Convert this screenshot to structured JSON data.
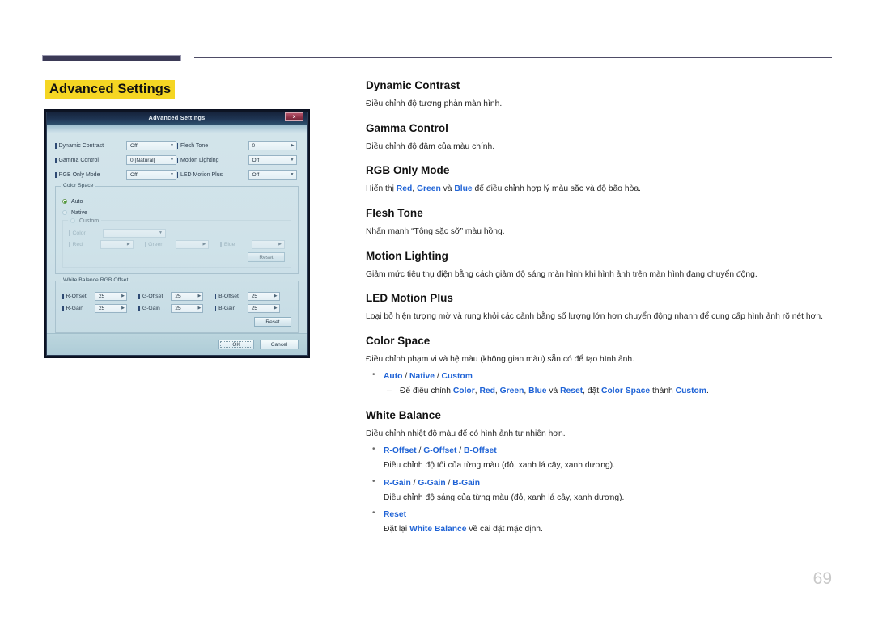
{
  "page": {
    "title": "Advanced Settings",
    "number": "69",
    "accent_highlight": "#f5d623",
    "rule_color": "#3b3a56",
    "link_color": "#1f63d6"
  },
  "dialog": {
    "title": "Advanced Settings",
    "close_label": "x",
    "fields_left": [
      {
        "label": "Dynamic Contrast",
        "value": "Off"
      },
      {
        "label": "Gamma Control",
        "value": "0 [Natural]"
      },
      {
        "label": "RGB Only Mode",
        "value": "Off"
      }
    ],
    "fields_right": [
      {
        "label": "Flesh Tone",
        "value": "0"
      },
      {
        "label": "Motion Lighting",
        "value": "Off"
      },
      {
        "label": "LED Motion Plus",
        "value": "Off"
      }
    ],
    "color_space": {
      "group_label": "Color Space",
      "options": [
        {
          "label": "Auto",
          "selected": true
        },
        {
          "label": "Native",
          "selected": false
        },
        {
          "label": "Custom",
          "selected": false
        }
      ],
      "custom": {
        "color_label": "Color",
        "color_value": "",
        "red_label": "Red",
        "red_value": "",
        "green_label": "Green",
        "green_value": "",
        "blue_label": "Blue",
        "blue_value": "",
        "reset_label": "Reset"
      }
    },
    "white_balance": {
      "group_label": "White Balance RGB Offset",
      "rows": [
        {
          "a_label": "R-Offset",
          "a_value": "25",
          "b_label": "G-Offset",
          "b_value": "25",
          "c_label": "B-Offset",
          "c_value": "25"
        },
        {
          "a_label": "R-Gain",
          "a_value": "25",
          "b_label": "G-Gain",
          "b_value": "25",
          "c_label": "B-Gain",
          "c_value": "25"
        }
      ],
      "reset_label": "Reset"
    },
    "ok_label": "OK",
    "cancel_label": "Cancel"
  },
  "sections": {
    "dynamic_contrast": {
      "heading": "Dynamic Contrast",
      "body": "Điều chỉnh độ tương phản màn hình."
    },
    "gamma_control": {
      "heading": "Gamma Control",
      "body": "Điều chỉnh độ đậm của màu chính."
    },
    "rgb_only_mode": {
      "heading": "RGB Only Mode",
      "body_pre": "Hiển thị ",
      "link_red": "Red",
      "sep1": ", ",
      "link_green": "Green",
      "sep2": " và ",
      "link_blue": "Blue",
      "body_post": " để điều chỉnh hợp lý màu sắc và độ bão hòa."
    },
    "flesh_tone": {
      "heading": "Flesh Tone",
      "body": "Nhấn mạnh “Tông sặc sỡ” màu hồng."
    },
    "motion_lighting": {
      "heading": "Motion Lighting",
      "body": "Giảm mức tiêu thụ điện bằng cách giảm độ sáng màn hình khi hình ảnh trên màn hình đang chuyển động."
    },
    "led_motion_plus": {
      "heading": "LED Motion Plus",
      "body": "Loại bỏ hiện tượng mờ và rung khỏi các cảnh bằng số lượng lớn hơn chuyển động nhanh để cung cấp hình ảnh rõ nét hơn."
    },
    "color_space": {
      "heading": "Color Space",
      "body": "Điều chỉnh phạm vi và hệ màu (không gian màu) sẵn có để tạo hình ảnh.",
      "bullet": {
        "opt_auto": "Auto",
        "slash1": " / ",
        "opt_native": "Native",
        "slash2": " / ",
        "opt_custom": "Custom",
        "dash_pre": "Để điều chỉnh ",
        "dash_color": "Color",
        "dash_s1": ", ",
        "dash_red": "Red",
        "dash_s2": ", ",
        "dash_green": "Green",
        "dash_s3": ", ",
        "dash_blue": "Blue",
        "dash_s4": " và ",
        "dash_reset": "Reset",
        "dash_s5": ", đặt ",
        "dash_colorspace": "Color Space",
        "dash_s6": " thành ",
        "dash_customval": "Custom",
        "dash_end": "."
      }
    },
    "white_balance": {
      "heading": "White Balance",
      "body": "Điều chỉnh nhiệt độ màu để có hình ảnh tự nhiên hơn.",
      "bullets": [
        {
          "a": "R-Offset",
          "s1": " / ",
          "b": "G-Offset",
          "s2": " / ",
          "c": "B-Offset",
          "sub": "Điều chỉnh độ tối của từng màu (đỏ, xanh lá cây, xanh dương)."
        },
        {
          "a": "R-Gain",
          "s1": " / ",
          "b": "G-Gain",
          "s2": " / ",
          "c": "B-Gain",
          "sub": "Điều chỉnh độ sáng của từng màu (đỏ, xanh lá cây, xanh dương)."
        }
      ],
      "reset_bullet": {
        "label": "Reset",
        "sub_pre": "Đặt lại ",
        "sub_link": "White Balance",
        "sub_post": " về cài đặt mặc định."
      }
    }
  }
}
